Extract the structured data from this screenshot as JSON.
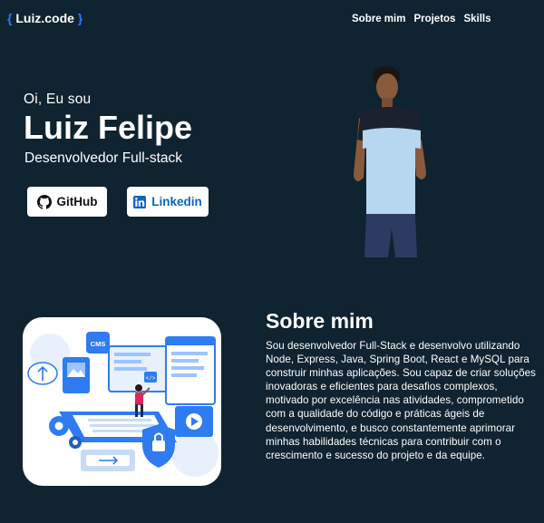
{
  "nav": {
    "logo_open": "{",
    "logo_text": "Luiz.code",
    "logo_close": "}",
    "links": [
      "Sobre mim",
      "Projetos",
      "Skills"
    ]
  },
  "hero": {
    "greeting": "Oi, Eu sou",
    "name": "Luiz Felipe",
    "role": "Desenvolvedor Full-stack",
    "buttons": {
      "github": "GitHub",
      "linkedin": "Linkedin"
    }
  },
  "about": {
    "title": "Sobre mim",
    "text": "Sou desenvolvedor Full-Stack e desenvolvo utilizando Node, Express, Java, Spring Boot, React e MySQL para construir minhas aplicações. Sou capaz de criar soluções inovadoras e eficientes para desafios complexos, motivado por excelência nas atividades, comprometido com a qualidade do código e práticas ágeis de desenvolvimento, e busco constantemente aprimorar minhas habilidades técnicas para contribuir com o crescimento e sucesso do projeto e da equipe.",
    "illustration_label": "CMS"
  },
  "icons": {
    "github": "github-icon",
    "linkedin": "linkedin-icon"
  },
  "colors": {
    "background": "#0f2330",
    "accent": "#2f7bf0",
    "linkedin": "#0a66c2"
  }
}
